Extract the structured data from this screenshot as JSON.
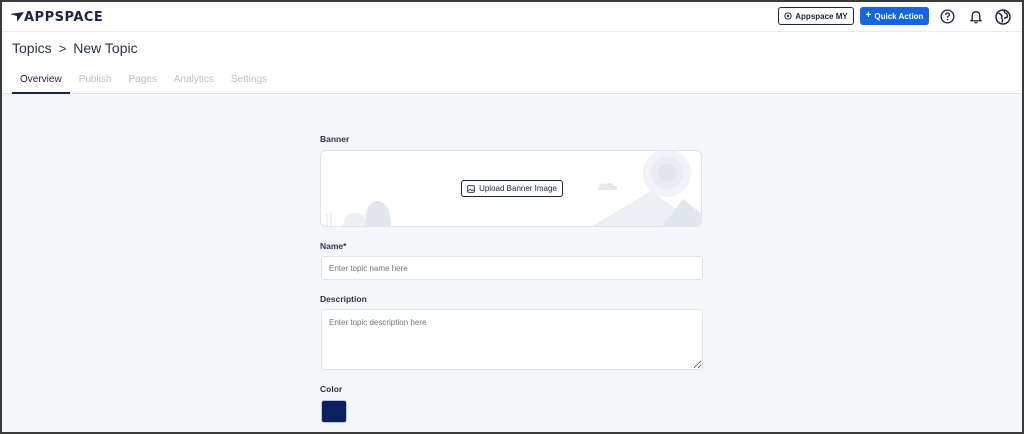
{
  "app": {
    "logo": "APPSPACE"
  },
  "topbar": {
    "appspace_label": "Appspace MY",
    "quick_action_label": "Quick Action"
  },
  "breadcrumb": {
    "root": "Topics",
    "separator": ">",
    "current": "New Topic"
  },
  "tabs": [
    {
      "label": "Overview",
      "active": true
    },
    {
      "label": "Publish",
      "active": false
    },
    {
      "label": "Pages",
      "active": false
    },
    {
      "label": "Analytics",
      "active": false
    },
    {
      "label": "Settings",
      "active": false
    }
  ],
  "form": {
    "banner_label": "Banner",
    "upload_label": "Upload Banner Image",
    "name_label": "Name*",
    "name_placeholder": "Enter topic name here",
    "description_label": "Description",
    "description_placeholder": "Enter topic description here",
    "color_label": "Color",
    "color_value": "#0c1f5f"
  },
  "colors": {
    "brand_navy": "#1b2540",
    "primary_blue": "#1565e0"
  }
}
